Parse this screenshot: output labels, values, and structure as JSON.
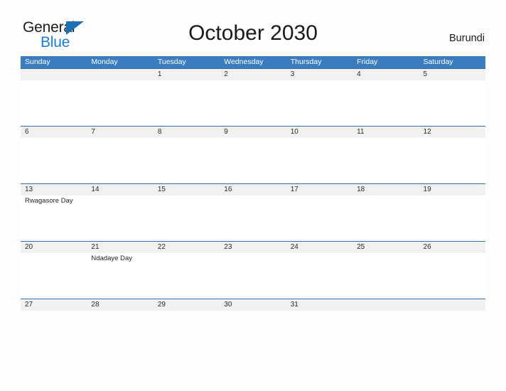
{
  "logo": {
    "line1": "General",
    "line2": "Blue",
    "triangle_icon": "triangle-icon",
    "line1_color": "#1c1c1c",
    "line2_color": "#1a7fd4",
    "triangle_color": "#1a6fb5"
  },
  "header": {
    "title": "October 2030",
    "country": "Burundi"
  },
  "colors": {
    "header_blue": "#3a7cc0",
    "row_divider_blue": "#2f6fae",
    "date_strip_gray": "#f1f1f1",
    "page_background": "#fdfdfd",
    "text": "#1f1f1f"
  },
  "calendar": {
    "month": "October",
    "year": "2030",
    "weekday_headers": [
      "Sunday",
      "Monday",
      "Tuesday",
      "Wednesday",
      "Thursday",
      "Friday",
      "Saturday"
    ],
    "weeks": [
      {
        "days": [
          {
            "date": "",
            "events": []
          },
          {
            "date": "",
            "events": []
          },
          {
            "date": "1",
            "events": []
          },
          {
            "date": "2",
            "events": []
          },
          {
            "date": "3",
            "events": []
          },
          {
            "date": "4",
            "events": []
          },
          {
            "date": "5",
            "events": []
          }
        ]
      },
      {
        "days": [
          {
            "date": "6",
            "events": []
          },
          {
            "date": "7",
            "events": []
          },
          {
            "date": "8",
            "events": []
          },
          {
            "date": "9",
            "events": []
          },
          {
            "date": "10",
            "events": []
          },
          {
            "date": "11",
            "events": []
          },
          {
            "date": "12",
            "events": []
          }
        ]
      },
      {
        "days": [
          {
            "date": "13",
            "events": [
              "Rwagasore Day"
            ]
          },
          {
            "date": "14",
            "events": []
          },
          {
            "date": "15",
            "events": []
          },
          {
            "date": "16",
            "events": []
          },
          {
            "date": "17",
            "events": []
          },
          {
            "date": "18",
            "events": []
          },
          {
            "date": "19",
            "events": []
          }
        ]
      },
      {
        "days": [
          {
            "date": "20",
            "events": []
          },
          {
            "date": "21",
            "events": [
              "Ndadaye Day"
            ]
          },
          {
            "date": "22",
            "events": []
          },
          {
            "date": "23",
            "events": []
          },
          {
            "date": "24",
            "events": []
          },
          {
            "date": "25",
            "events": []
          },
          {
            "date": "26",
            "events": []
          }
        ]
      },
      {
        "days": [
          {
            "date": "27",
            "events": []
          },
          {
            "date": "28",
            "events": []
          },
          {
            "date": "29",
            "events": []
          },
          {
            "date": "30",
            "events": []
          },
          {
            "date": "31",
            "events": []
          },
          {
            "date": "",
            "events": []
          },
          {
            "date": "",
            "events": []
          }
        ]
      }
    ]
  }
}
